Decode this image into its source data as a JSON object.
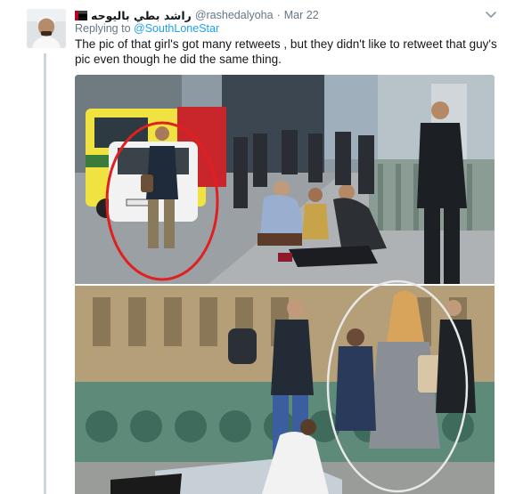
{
  "tweet": {
    "avatar_icon": "user-avatar-photo",
    "display_name": "راشد بطي باليوحه",
    "handle": "@rashedalyoha",
    "separator": "·",
    "date": "Mar 22",
    "reply_prefix": "Replying to",
    "reply_to": "@SouthLoneStar",
    "text": "The pic of that girl's got many retweets , but they didn't like to retweet that guy's pic even though he did the same thing.",
    "more_icon": "chevron-down-icon"
  },
  "media": {
    "top_photo": "bridge-scene-man-circled",
    "bottom_photo": "bridge-scene-woman-circled",
    "highlight_color": "#e02020"
  },
  "colors": {
    "link": "#1da1f2",
    "secondary_text": "#657786",
    "thread_line": "#ccd6dd"
  }
}
